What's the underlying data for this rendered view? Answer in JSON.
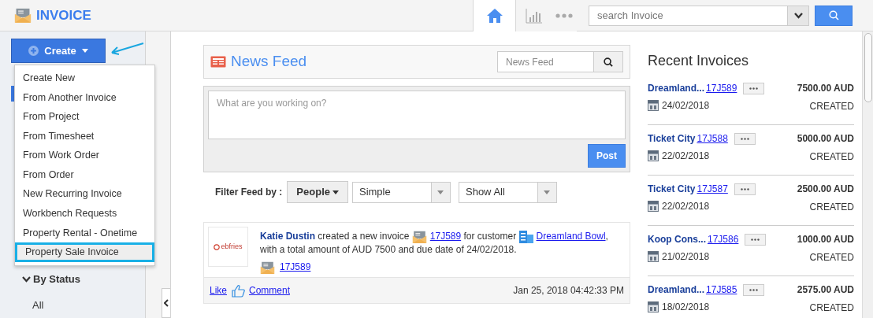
{
  "header": {
    "app_title": "INVOICE",
    "nav_tabs": [
      {
        "kind": "home",
        "selected": true
      },
      {
        "kind": "chart",
        "selected": false
      },
      {
        "kind": "more",
        "selected": false
      }
    ],
    "search": {
      "placeholder": "search Invoice"
    }
  },
  "sidebar": {
    "create_button": "Create",
    "create_menu": [
      {
        "label": "Create New",
        "selected": false
      },
      {
        "label": "From Another Invoice",
        "selected": false
      },
      {
        "label": "From Project",
        "selected": false
      },
      {
        "label": "From Timesheet",
        "selected": false
      },
      {
        "label": "From Work Order",
        "selected": false
      },
      {
        "label": "From Order",
        "selected": false
      },
      {
        "label": "New Recurring Invoice",
        "selected": false
      },
      {
        "label": "Workbench Requests",
        "selected": false
      },
      {
        "label": "Property Rental - Onetime",
        "selected": false
      },
      {
        "label": "Property Sale Invoice",
        "selected": true
      }
    ],
    "section": {
      "title": "By Status",
      "expanded": true,
      "items": [
        "All"
      ]
    }
  },
  "news_feed": {
    "title": "News Feed",
    "search_placeholder": "News Feed",
    "composer_placeholder": "What are you working on?",
    "post_button": "Post",
    "filter_label": "Filter Feed by :",
    "people_button": "People",
    "selects": [
      "Simple",
      "Show All"
    ],
    "items": [
      {
        "avatar_logo": "ebfries",
        "author": "Katie Dustin",
        "action": "created a new invoice",
        "invoice_link": "17J589",
        "customer_text": "for customer",
        "customer_link": "Dreamland Bowl",
        "rest": ", with a total amount of AUD 7500 and due date of 24/02/2018.",
        "attachment_link": "17J589",
        "like": "Like",
        "comment": "Comment",
        "timestamp": "Jan 25, 2018 04:42:33 PM"
      }
    ]
  },
  "recent_invoices": {
    "title": "Recent Invoices",
    "items": [
      {
        "customer": "Dreamland...",
        "number": "17J589",
        "date": "24/02/2018",
        "amount": "7500.00 AUD",
        "status": "CREATED"
      },
      {
        "customer": "Ticket City",
        "number": "17J588",
        "date": "22/02/2018",
        "amount": "5000.00 AUD",
        "status": "CREATED"
      },
      {
        "customer": "Ticket City",
        "number": "17J587",
        "date": "22/02/2018",
        "amount": "2500.00 AUD",
        "status": "CREATED"
      },
      {
        "customer": "Koop Cons...",
        "number": "17J586",
        "date": "21/02/2018",
        "amount": "1000.00 AUD",
        "status": "CREATED"
      },
      {
        "customer": "Dreamland...",
        "number": "17J585",
        "date": "18/02/2018",
        "amount": "2575.00 AUD",
        "status": "CREATED"
      }
    ]
  }
}
